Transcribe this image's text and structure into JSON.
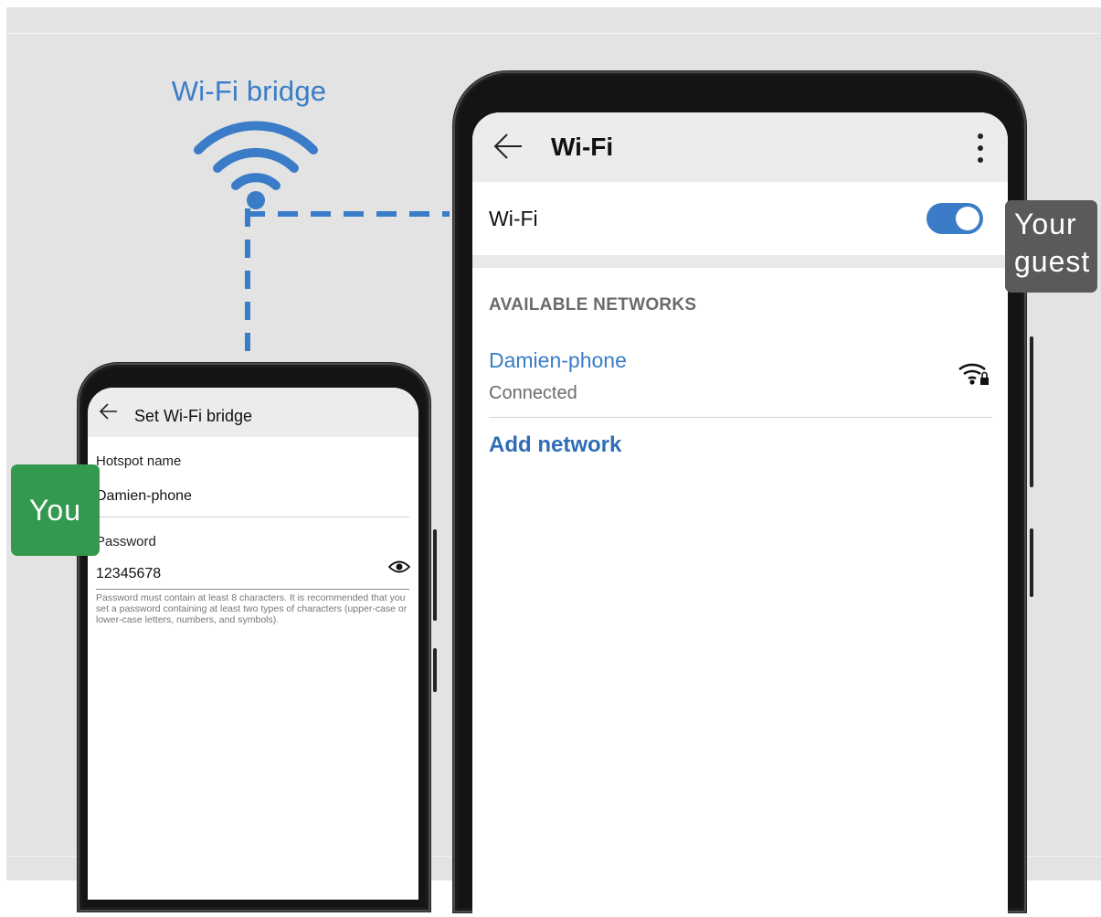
{
  "bridge": {
    "title": "Wi-Fi bridge"
  },
  "left_phone": {
    "header_title": "Set Wi-Fi bridge",
    "hotspot_label": "Hotspot name",
    "hotspot_value": "Damien-phone",
    "password_label": "Password",
    "password_value": "12345678",
    "hint": "Password must contain at least 8 characters. It is recommended that you set a password containing at least two types of characters (upper-case or lower-case letters, numbers, and symbols)."
  },
  "right_phone": {
    "header_title": "Wi-Fi",
    "wifi_label": "Wi-Fi",
    "wifi_enabled": true,
    "section_title": "AVAILABLE NETWORKS",
    "network": {
      "name": "Damien-phone",
      "status": "Connected"
    },
    "add_network": "Add network"
  },
  "tags": {
    "you": "You",
    "guest_line1": "Your",
    "guest_line2": "guest"
  },
  "colors": {
    "accent": "#3a7cc7",
    "you": "#33994f",
    "guest": "#5a5a5a",
    "background": "#e3e3e3"
  },
  "icons": [
    "wifi-icon",
    "back-arrow-icon",
    "eye-icon",
    "more-vertical-icon",
    "wifi-lock-icon"
  ]
}
